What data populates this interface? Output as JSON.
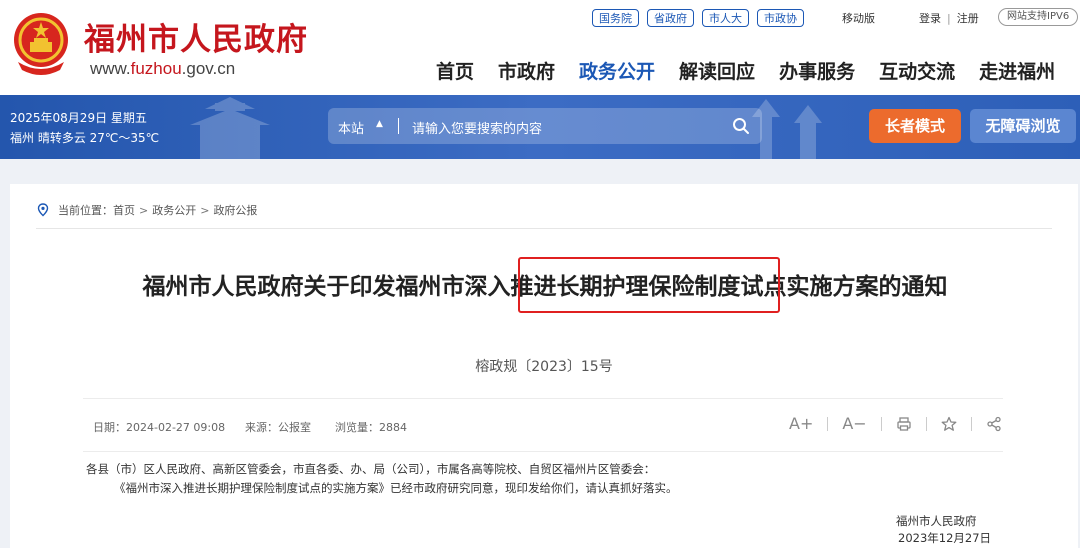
{
  "header": {
    "site_title": "福州市人民政府",
    "site_url_prefix": "www.",
    "site_url_brand": "fuzhou",
    "site_url_suffix": ".gov.cn",
    "top_badges": [
      "国务院",
      "省政府",
      "市人大",
      "市政协"
    ],
    "mobile_label": "移动版",
    "login_label": "登录",
    "separator": "|",
    "register_label": "注册",
    "ipv6_label": "网站支持IPV6",
    "nav": [
      {
        "label": "首页",
        "active": false
      },
      {
        "label": "市政府",
        "active": false
      },
      {
        "label": "政务公开",
        "active": true
      },
      {
        "label": "解读回应",
        "active": false
      },
      {
        "label": "办事服务",
        "active": false
      },
      {
        "label": "互动交流",
        "active": false
      },
      {
        "label": "走进福州",
        "active": false
      }
    ]
  },
  "band": {
    "date": "2025年08月29日 星期五",
    "weather": "福州 晴转多云 27℃～35℃",
    "search_scope": "本站",
    "search_placeholder": "请输入您要搜索的内容",
    "elder_mode": "长者模式",
    "accessible": "无障碍浏览"
  },
  "breadcrumb": {
    "prefix": "当前位置：",
    "items": [
      "首页",
      "政务公开",
      "政府公报"
    ],
    "sep": ">"
  },
  "article": {
    "title": "福州市人民政府关于印发福州市深入推进长期护理保险制度试点实施方案的通知",
    "doc_number": "榕政规〔2023〕15号",
    "date": "日期：2024-02-27 09:08",
    "source": "来源：公报室",
    "views": "浏览量：2884",
    "font_larger": "A+",
    "font_smaller": "A−",
    "addressee": "各县（市）区人民政府、高新区管委会，市直各委、办、局（公司），市属各高等院校、自贸区福州片区管委会：",
    "body": "《福州市深入推进长期护理保险制度试点的实施方案》已经市政府研究同意，现印发给你们，请认真抓好落实。",
    "sign_org": "福州市人民政府",
    "sign_date": "2023年12月27日"
  },
  "colors": {
    "brand_red": "#c5161d",
    "nav_active_blue": "#1c58b5",
    "elder_orange": "#ec6b2d",
    "highlight_red": "#e02020"
  }
}
